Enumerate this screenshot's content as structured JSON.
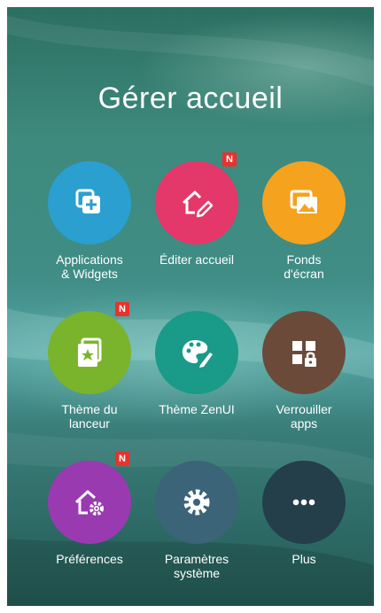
{
  "title": "Gérer accueil",
  "badge_text": "N",
  "items": [
    {
      "label": "Applications\n& Widgets",
      "icon": "add-widget-icon",
      "color": "#2a9fd0",
      "badge": false
    },
    {
      "label": "Éditer accueil",
      "icon": "edit-home-icon",
      "color": "#e4386a",
      "badge": true
    },
    {
      "label": "Fonds\nd'écran",
      "icon": "wallpaper-icon",
      "color": "#f5a21f",
      "badge": false
    },
    {
      "label": "Thème du\nlanceur",
      "icon": "launcher-theme-icon",
      "color": "#79b42c",
      "badge": true
    },
    {
      "label": "Thème ZenUI",
      "icon": "palette-icon",
      "color": "#1a9a88",
      "badge": false
    },
    {
      "label": "Verrouiller\napps",
      "icon": "lock-apps-icon",
      "color": "#6b4a3a",
      "badge": false
    },
    {
      "label": "Préférences",
      "icon": "home-settings-icon",
      "color": "#9a3ab0",
      "badge": true
    },
    {
      "label": "Paramètres\nsystème",
      "icon": "gear-icon",
      "color": "#3b6478",
      "badge": false
    },
    {
      "label": "Plus",
      "icon": "more-icon",
      "color": "#243e4a",
      "badge": false
    }
  ]
}
